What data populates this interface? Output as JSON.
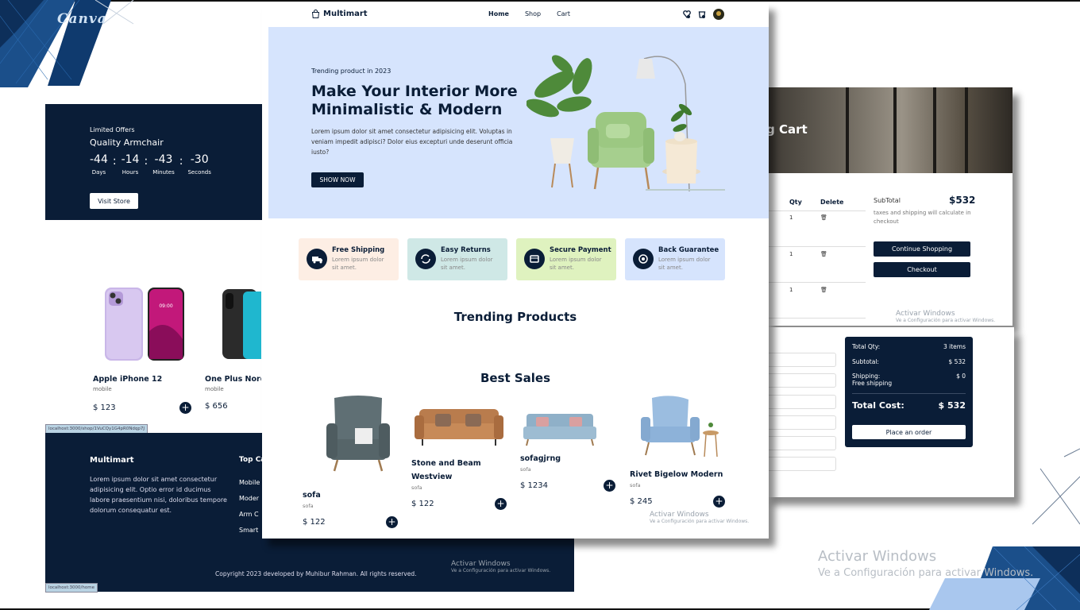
{
  "watermark": {
    "canva": "Canva"
  },
  "offer": {
    "limited": "Limited Offers",
    "title": "Quality Armchair",
    "countdown": [
      {
        "value": "-44",
        "label": "Days"
      },
      {
        "value": "-14",
        "label": "Hours"
      },
      {
        "value": "-43",
        "label": "Minutes"
      },
      {
        "value": "-30",
        "label": "Seconds"
      }
    ],
    "sep": ":",
    "visit_button": "Visit Store"
  },
  "phones": {
    "items": [
      {
        "name": "Apple iPhone 12",
        "category": "mobile",
        "price": "$ 123",
        "add": "+"
      },
      {
        "name": "One Plus Nord",
        "category": "mobile",
        "price": "$ 656"
      }
    ],
    "url_tag": "localhost:3000/shop/1VuCQy1G4pR0Ndqp7J"
  },
  "footer": {
    "brand": "Multimart",
    "description": "Lorem ipsum dolor sit amet consectetur adipisicing elit. Optio error id ducimus labore praesentium nisi, doloribus tempore dolorum consequatur est.",
    "top_categories": "Top Ca",
    "links": [
      "Mobile",
      "Moder",
      "Arm C",
      "Smart"
    ],
    "copyright": "Copyright 2023 developed by Muhibur Rahman. All rights reserved.",
    "url_tag": "localhost:3000/home"
  },
  "activate": {
    "title": "Activar Windows",
    "sub": "Ve a Configuración para activar Windows."
  },
  "nav": {
    "brand": "Multimart",
    "links": [
      "Home",
      "Shop",
      "Cart"
    ]
  },
  "hero": {
    "subtitle": "Trending product in 2023",
    "title": "Make Your Interior More Minimalistic & Modern",
    "text": "Lorem ipsum dolor sit amet consectetur adipisicing elit. Voluptas in veniam impedit adipisci? Dolor eius excepturi unde deserunt officia iusto?",
    "button": "SHOW NOW"
  },
  "features": [
    {
      "title": "Free Shipping",
      "text": "Lorem ipsum dolor sit amet.",
      "color": "#fdeee4"
    },
    {
      "title": "Easy Returns",
      "text": "Lorem ipsum dolor sit amet.",
      "color": "#cfe8e6"
    },
    {
      "title": "Secure Payment",
      "text": "Lorem ipsum dolor sit amet.",
      "color": "#dff2bf"
    },
    {
      "title": "Back Guarantee",
      "text": "Lorem ipsum dolor sit amet.",
      "color": "#d6e4fd"
    }
  ],
  "sections": {
    "trending": "Trending Products",
    "best": "Best Sales"
  },
  "best_sales": [
    {
      "name": "sofa",
      "category": "sofa",
      "price": "$ 122",
      "add": "+"
    },
    {
      "name": "Stone and Beam Westview",
      "category": "sofa",
      "price": "$ 122",
      "add": "+"
    },
    {
      "name": "sofagjrng",
      "category": "sofa",
      "price": "$ 1234",
      "add": "+"
    },
    {
      "name": "Rivet Bigelow Modern",
      "category": "sofa",
      "price": "$ 245",
      "add": "+"
    }
  ],
  "cart": {
    "title": "g Cart",
    "headers": {
      "qty": "Qty",
      "delete": "Delete"
    },
    "rows": [
      {
        "qty": "1"
      },
      {
        "qty": "1"
      },
      {
        "qty": "1"
      }
    ],
    "subtotal_label": "SubTotal",
    "subtotal_value": "$532",
    "tax_note": "taxes and shipping will calculate in checkout",
    "continue": "Continue Shopping",
    "checkout": "Checkout"
  },
  "checkout": {
    "total_qty_label": "Total Qty:",
    "total_qty_value": "3 items",
    "subtotal_label": "Subtotal:",
    "subtotal_value": "$ 532",
    "shipping_label": "Shipping:",
    "shipping_free": "Free shipping",
    "shipping_value": "$ 0",
    "total_label": "Total Cost:",
    "total_value": "$ 532",
    "place_order": "Place an order"
  },
  "colors": {
    "navy": "#0a1d37",
    "hero_bg": "#d6e4fd"
  }
}
